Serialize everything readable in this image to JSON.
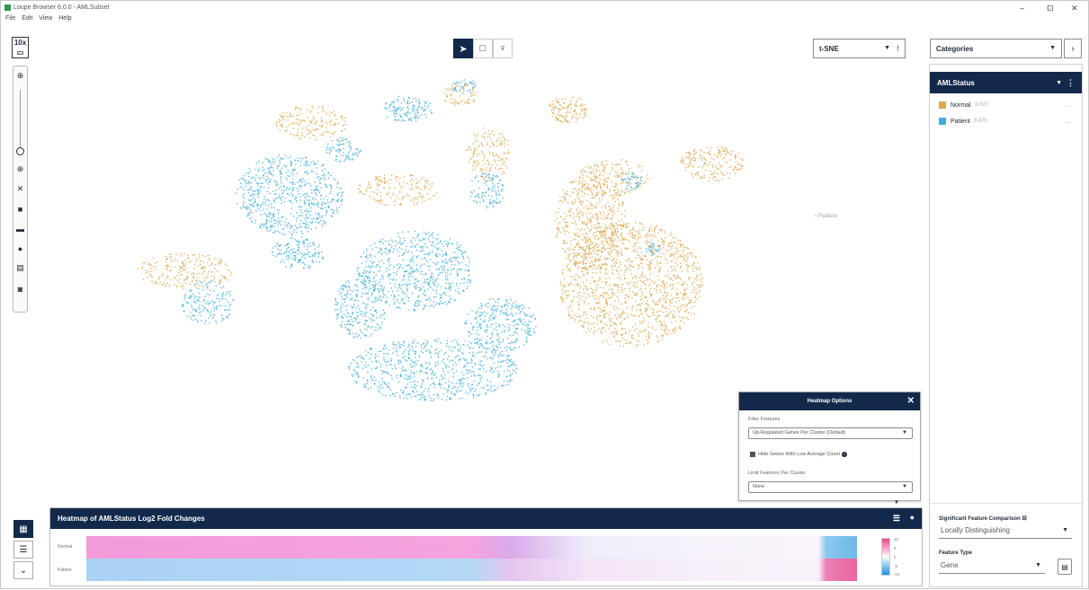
{
  "window": {
    "title": "Loupe Browser 6.0.0 - AMLSubset",
    "controls": [
      "–",
      "⊡",
      "✕"
    ],
    "menu": [
      "File",
      "Edit",
      "View",
      "Help"
    ]
  },
  "toolbar": {
    "modes": [
      "pointer",
      "box-select",
      "lasso-select"
    ]
  },
  "projection": {
    "selected": "t-SNE"
  },
  "category_select": {
    "selected": "Categories"
  },
  "left_tools": [
    "zoom-in-top",
    "zoom-slider",
    "zoom-in",
    "fit",
    "save",
    "folder",
    "camera",
    "table",
    "screenshot"
  ],
  "right_panel": {
    "header": "AMLStatus",
    "categories": [
      {
        "label": "Normal",
        "count": "3,020",
        "color": "#e0a64a"
      },
      {
        "label": "Patient",
        "count": "3,876",
        "color": "#3cb0e0"
      }
    ],
    "significant_label": "Significant Feature Comparison ☒",
    "significant_value": "Locally Distinguishing",
    "feature_type_label": "Feature Type",
    "feature_type_value": "Gene"
  },
  "plot": {
    "lone_label": "~ Feature"
  },
  "heatmap_options": {
    "title": "Heatmap Options",
    "filter_label": "Filter Features",
    "filter_value": "Up-Regulated Genes Per Cluster (Default)",
    "hide_label": "Hide Genes With Low Average Count",
    "limit_label": "Limit Features Per Cluster",
    "limit_value": "None"
  },
  "heatmap": {
    "title": "Heatmap of AMLStatus Log2 Fold Changes",
    "rows": [
      "Normal",
      "Patient"
    ],
    "scale_ticks": [
      "10",
      "5",
      "0",
      "-5",
      "-10"
    ]
  },
  "colors": {
    "navy": "#13294b",
    "normal": "#e0a64a",
    "patient": "#3cb0e0",
    "pink": "#e8488a",
    "blue": "#1f8fe0"
  }
}
